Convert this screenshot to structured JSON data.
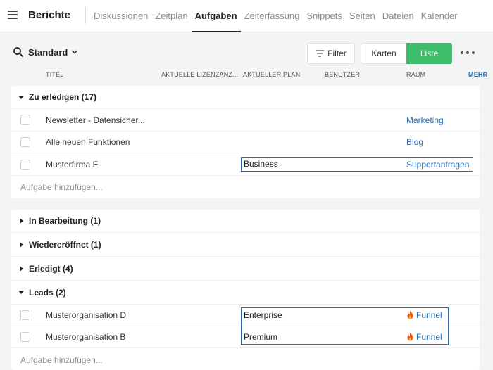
{
  "app": {
    "title": "Berichte"
  },
  "nav": {
    "tabs": [
      "Diskussionen",
      "Zeitplan",
      "Aufgaben",
      "Zeiterfassung",
      "Snippets",
      "Seiten",
      "Dateien",
      "Kalender"
    ],
    "active": "Aufgaben"
  },
  "view": {
    "name": "Standard",
    "filter_label": "Filter",
    "karten_label": "Karten",
    "liste_label": "Liste"
  },
  "columns": {
    "title": "TITEL",
    "license": "AKTUELLE LIZENZANZ...",
    "plan": "AKTUELLER PLAN",
    "user": "BENUTZER",
    "room": "RAUM",
    "more": "MEHR"
  },
  "groups": {
    "todo": {
      "label": "Zu erledigen (17)",
      "add_label": "Aufgabe hinzufügen..."
    },
    "in_progress": {
      "label": "In Bearbeitung (1)"
    },
    "reopened": {
      "label": "Wiedereröffnet (1)"
    },
    "done": {
      "label": "Erledigt (4)"
    },
    "leads": {
      "label": "Leads (2)",
      "add_label": "Aufgabe hinzufügen..."
    }
  },
  "todo_rows": [
    {
      "title": "Newsletter - Datensicher...",
      "plan": "",
      "room": "Marketing"
    },
    {
      "title": "Alle neuen Funktionen",
      "plan": "",
      "room": "Blog"
    },
    {
      "title": "Musterfirma E",
      "plan": "Business",
      "room": "Supportanfragen"
    }
  ],
  "lead_rows": [
    {
      "title": "Musterorganisation D",
      "plan": "Enterprise",
      "room": "Funnel"
    },
    {
      "title": "Musterorganisation B",
      "plan": "Premium",
      "room": "Funnel"
    }
  ],
  "colors": {
    "accent_green": "#3ebd6b",
    "link_blue": "#2a6fb5",
    "highlight_border": "#2d6aa7"
  }
}
